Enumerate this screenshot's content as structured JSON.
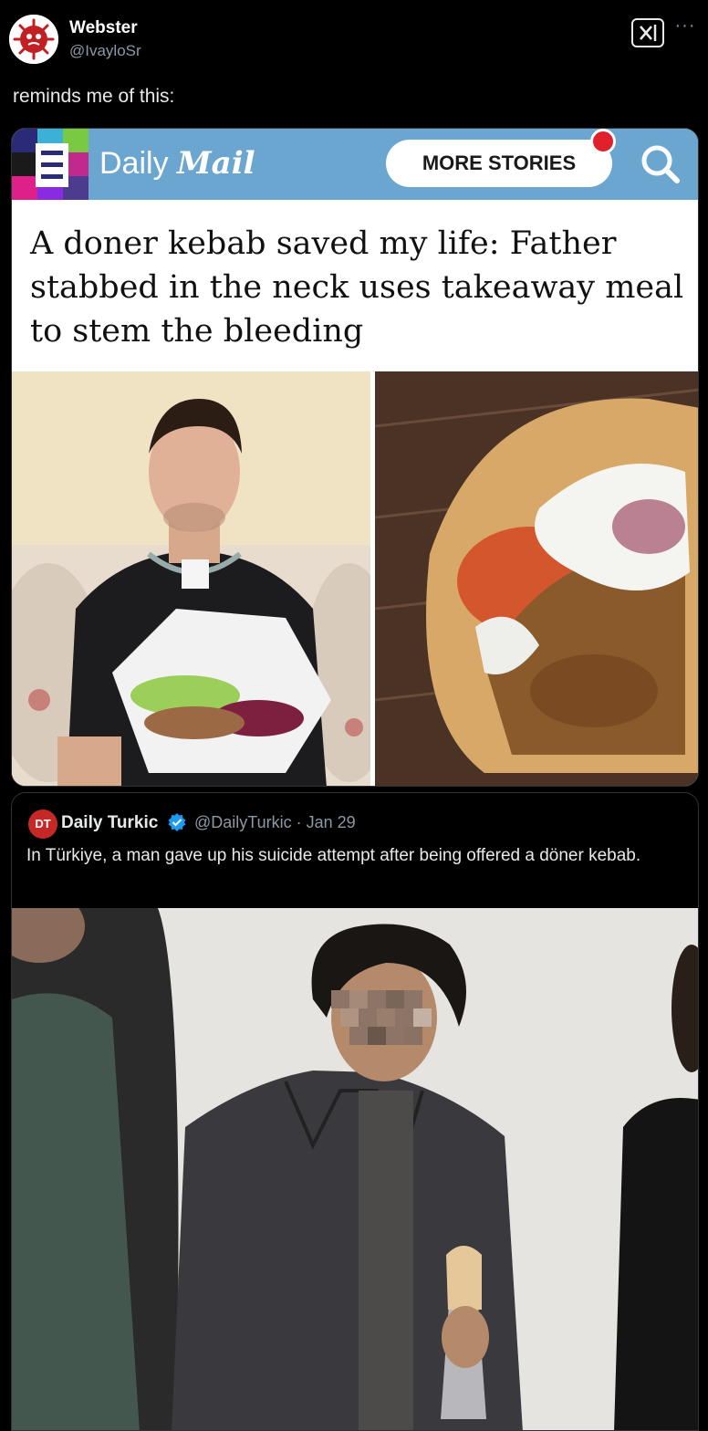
{
  "author": {
    "name": "Webster",
    "handle": "@IvayloSr"
  },
  "tweet": {
    "text": "reminds me of this:"
  },
  "article": {
    "brand_prefix": "Daily",
    "brand_suffix": "Mail",
    "more_stories_label": "MORE STORIES",
    "headline": "A doner kebab saved my life: Father stabbed in the neck uses takeaway meal to stem the bleeding"
  },
  "quoted_tweet": {
    "avatar_text": "DT",
    "name": "Daily Turkic",
    "handle_date": "@DailyTurkic · Jan 29",
    "text": "In Türkiye, a man gave up his suicide attempt after being offered a döner kebab."
  },
  "icons": {
    "more": "more-icon",
    "grok": "grok-icon",
    "search": "search-icon",
    "verified": "verified-badge-icon",
    "menu": "menu-icon"
  },
  "colors": {
    "background": "#000000",
    "text": "#e7e9ea",
    "muted": "#8b98a5",
    "dm_blue": "#6aa6cf",
    "notif_red": "#e0202a",
    "verified_blue": "#1d9bf0"
  }
}
